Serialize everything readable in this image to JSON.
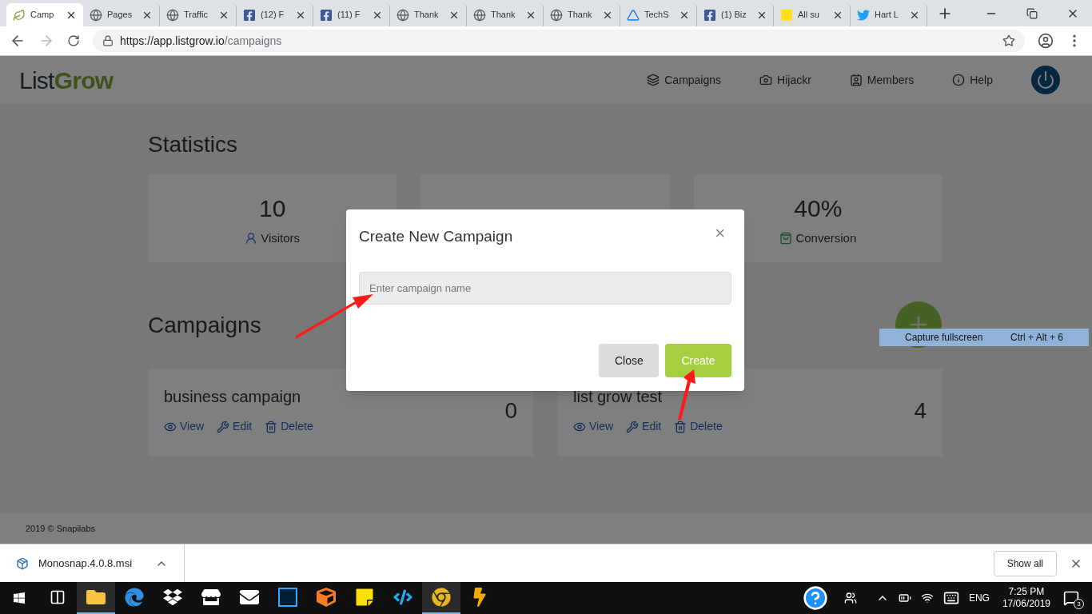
{
  "browser": {
    "tabs": [
      {
        "title": "Camp",
        "kind": "leaf",
        "selected": true
      },
      {
        "title": "Pages",
        "kind": "globe",
        "selected": false
      },
      {
        "title": "Traffic",
        "kind": "globe",
        "selected": false
      },
      {
        "title": "(12) F",
        "kind": "facebook",
        "selected": false
      },
      {
        "title": "(11) F",
        "kind": "facebook",
        "selected": false
      },
      {
        "title": "Thank",
        "kind": "globe",
        "selected": false
      },
      {
        "title": "Thank",
        "kind": "globe",
        "selected": false
      },
      {
        "title": "Thank",
        "kind": "globe",
        "selected": false
      },
      {
        "title": "TechS",
        "kind": "triangle",
        "selected": false
      },
      {
        "title": "(1) Biz",
        "kind": "facebook",
        "selected": false
      },
      {
        "title": "All su",
        "kind": "mailchimp",
        "selected": false
      },
      {
        "title": "Hart L",
        "kind": "twitter",
        "selected": false
      }
    ],
    "url": {
      "host": "https://app.listgrow.io",
      "path": "/campaigns"
    }
  },
  "header": {
    "logo": {
      "first": "List",
      "second": "Grow"
    },
    "nav": [
      {
        "label": "Campaigns",
        "kind": "stack"
      },
      {
        "label": "Hijackr",
        "kind": "camera"
      },
      {
        "label": "Members",
        "kind": "card"
      },
      {
        "label": "Help",
        "kind": "info"
      }
    ]
  },
  "statistics": {
    "title": "Statistics",
    "cards": [
      {
        "value": "10",
        "label": "Visitors",
        "kind": "user"
      },
      {
        "kind": "covered"
      },
      {
        "value": "40%",
        "label": "Conversion",
        "kind": "bag"
      }
    ]
  },
  "campaigns": {
    "title": "Campaigns",
    "items": [
      {
        "name": "business campaign",
        "count": "0",
        "actions": [
          "View",
          "Edit",
          "Delete"
        ]
      },
      {
        "name": "list grow test",
        "count": "4",
        "actions": [
          "View",
          "Edit",
          "Delete"
        ]
      }
    ]
  },
  "footer": "2019 © Snapilabs",
  "modal": {
    "title": "Create New Campaign",
    "close": "×",
    "placeholder": "Enter campaign name",
    "buttons": [
      {
        "label": "Close",
        "kind": "secondary"
      },
      {
        "label": "Create",
        "kind": "primary"
      }
    ]
  },
  "tooltip": {
    "label": "Capture fullscreen",
    "shortcut": "Ctrl + Alt + 6"
  },
  "downloads": {
    "file": "Monosnap.4.0.8.msi",
    "show_all": "Show all"
  },
  "taskbar": {
    "apps": [
      {
        "kind": "taskview",
        "active": false
      },
      {
        "kind": "folder",
        "active": true
      },
      {
        "kind": "edge",
        "active": false
      },
      {
        "kind": "dropbox",
        "active": false
      },
      {
        "kind": "store",
        "active": false
      },
      {
        "kind": "mail",
        "active": false
      },
      {
        "kind": "photoshop",
        "active": false
      },
      {
        "kind": "xampp",
        "active": false
      },
      {
        "kind": "sticky",
        "active": false
      },
      {
        "kind": "code",
        "active": false
      },
      {
        "kind": "chrome",
        "active": true
      },
      {
        "kind": "bolt",
        "active": false
      }
    ],
    "lang": "ENG",
    "time": "7:25 PM",
    "date": "17/06/2019",
    "notifications": "3"
  }
}
